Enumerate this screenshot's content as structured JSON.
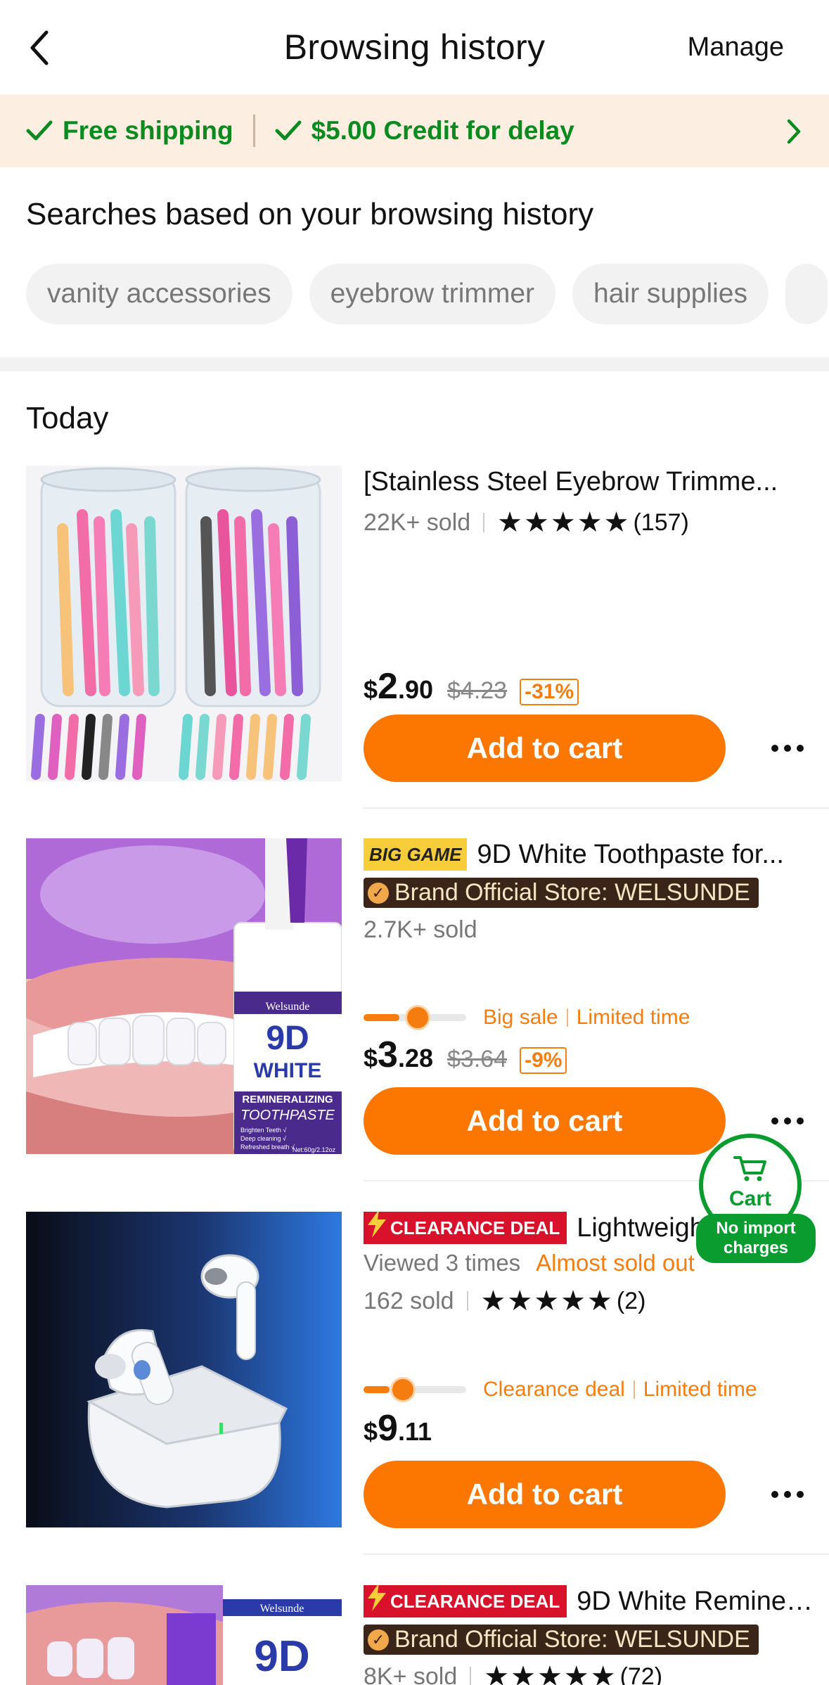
{
  "header": {
    "title": "Browsing history",
    "manage_label": "Manage"
  },
  "banner": {
    "free_shipping": "Free shipping",
    "credit": "$5.00 Credit for delay"
  },
  "searches": {
    "title": "Searches based on your browsing history",
    "chips": [
      "vanity accessories",
      "eyebrow trimmer",
      "hair supplies"
    ]
  },
  "section_today": "Today",
  "products": [
    {
      "title": "[Stainless Steel Eyebrow Trimme...",
      "sold": "22K+ sold",
      "rating_count": "(157)",
      "price_currency": "$",
      "price_int": "2",
      "price_dec": ".90",
      "price_old": "$4.23",
      "discount": "-31%",
      "add_label": "Add to cart"
    },
    {
      "badge": "BIG GAME",
      "title": "9D White Toothpaste for...",
      "store": "Brand Official Store: WELSUNDE",
      "sold": "2.7K+ sold",
      "deal_a": "Big sale",
      "deal_b": "Limited time",
      "deal_progress_pct": 35,
      "price_currency": "$",
      "price_int": "3",
      "price_dec": ".28",
      "price_old": "$3.64",
      "discount": "-9%",
      "add_label": "Add to cart",
      "thumb_text": {
        "brand": "Welsunde",
        "big": "9D",
        "white": "WHITE",
        "sub1": "REMINERALIZING",
        "sub2": "TOOTHPASTE",
        "b1": "Brighten Teeth √",
        "b2": "Deep cleaning √",
        "b3": "Refreshed breath √",
        "net": "Net:60g/2.12oz"
      }
    },
    {
      "badge": "CLEARANCE DEAL",
      "title": "Lightweight",
      "viewed": "Viewed 3 times",
      "almost": "Almost sold out",
      "sold": "162 sold",
      "rating_count": "(2)",
      "deal_a": "Clearance deal",
      "deal_b": "Limited time",
      "deal_progress_pct": 25,
      "price_currency": "$",
      "price_int": "9",
      "price_dec": ".11",
      "add_label": "Add to cart"
    },
    {
      "badge": "CLEARANCE DEAL",
      "title": "9D White Reminera...",
      "store": "Brand Official Store: WELSUNDE",
      "sold": "8K+ sold",
      "rating_count": "(72)",
      "thumb_text": {
        "brand": "Welsunde",
        "big": "9D"
      }
    }
  ],
  "float_cart": {
    "label": "Cart",
    "tag_line1": "No import",
    "tag_line2": "charges"
  },
  "colors": {
    "accent": "#fb7701",
    "green": "#0a8a1f",
    "banner_bg": "#fdeee2",
    "clearance_red": "#d8122a"
  }
}
